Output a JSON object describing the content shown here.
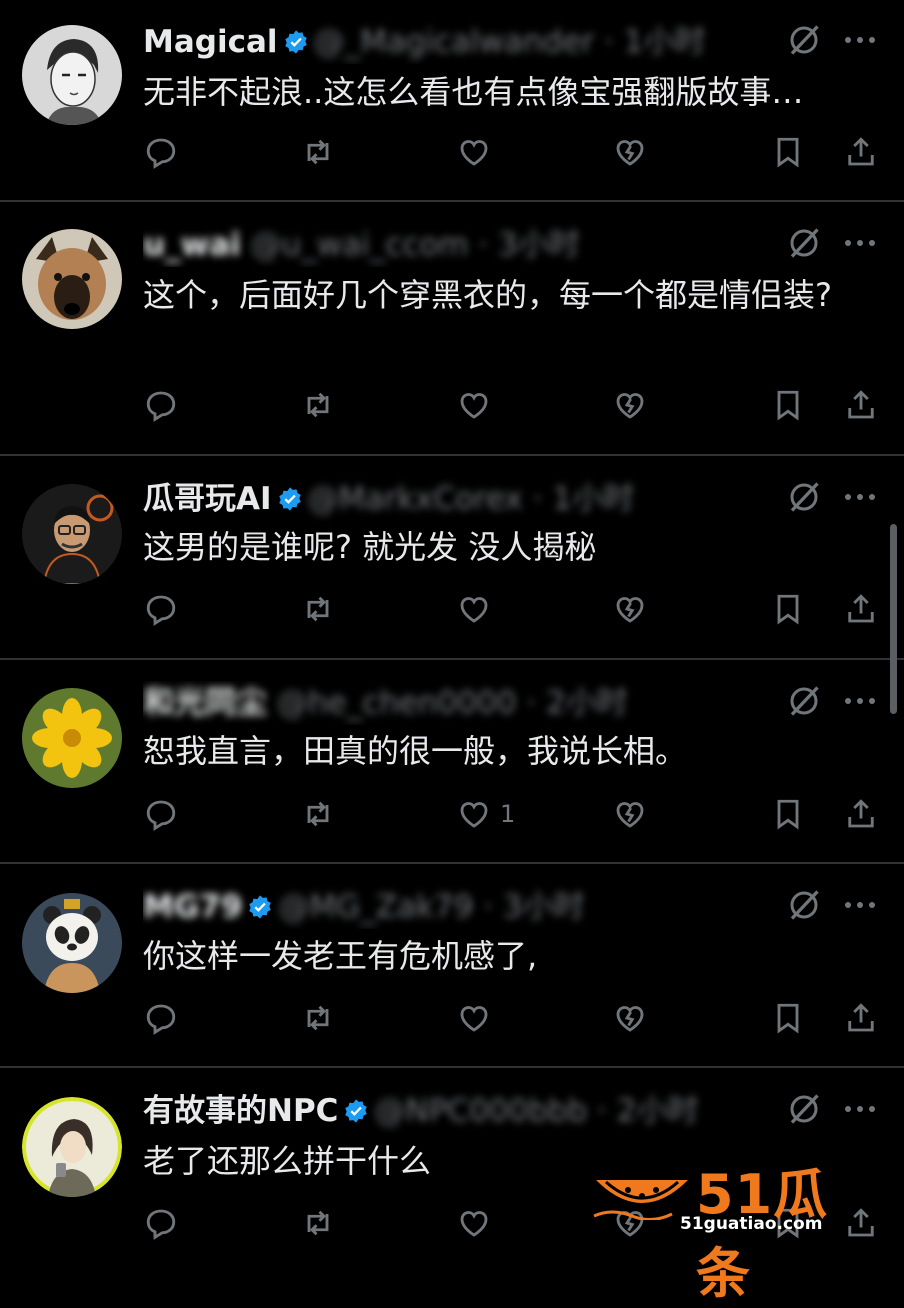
{
  "replies": [
    {
      "name": "Magical",
      "handle_time": "@_Magicalwander · 1小时",
      "text": "无非不起浪..这怎么看也有点像宝强翻版故事…",
      "like_count": "",
      "avatar": "anime-boy-avatar"
    },
    {
      "name": "u_wai",
      "handle_time": "@u_wai_ccom · 3小时",
      "text": "这个，后面好几个穿黑衣的，每一个都是情侣装?",
      "like_count": "",
      "avatar": "dog-avatar"
    },
    {
      "name": "瓜哥玩AI",
      "handle_time": "@MarkxCorex · 1小时",
      "text": "这男的是谁呢? 就光发 没人揭秘",
      "like_count": "",
      "avatar": "man-glasses-avatar"
    },
    {
      "name": "和光同尘",
      "handle_time": "@he_chen0000 · 2小时",
      "text": "恕我直言，田真的很一般，我说长相。",
      "like_count": "1",
      "avatar": "yellow-flower-avatar"
    },
    {
      "name": "MG79",
      "handle_time": "@MG_Zak79 · 3小时",
      "text": "你这样一发老王有危机感了,",
      "like_count": "",
      "avatar": "panda-avatar"
    },
    {
      "name": "有故事的NPC",
      "handle_time": "@NPC000bbb · 2小时",
      "text": "老了还那么拼干什么",
      "like_count": "",
      "avatar": "woman-drawing-avatar"
    }
  ],
  "colors": {
    "background": "#000000",
    "text": "#e7e9ea",
    "muted": "#71767b",
    "separator": "#2f3336",
    "verified": "#1d9bf0",
    "watermark": "#f0791e"
  },
  "watermark": {
    "brand": "51瓜条",
    "url": "51guatiao.com"
  }
}
